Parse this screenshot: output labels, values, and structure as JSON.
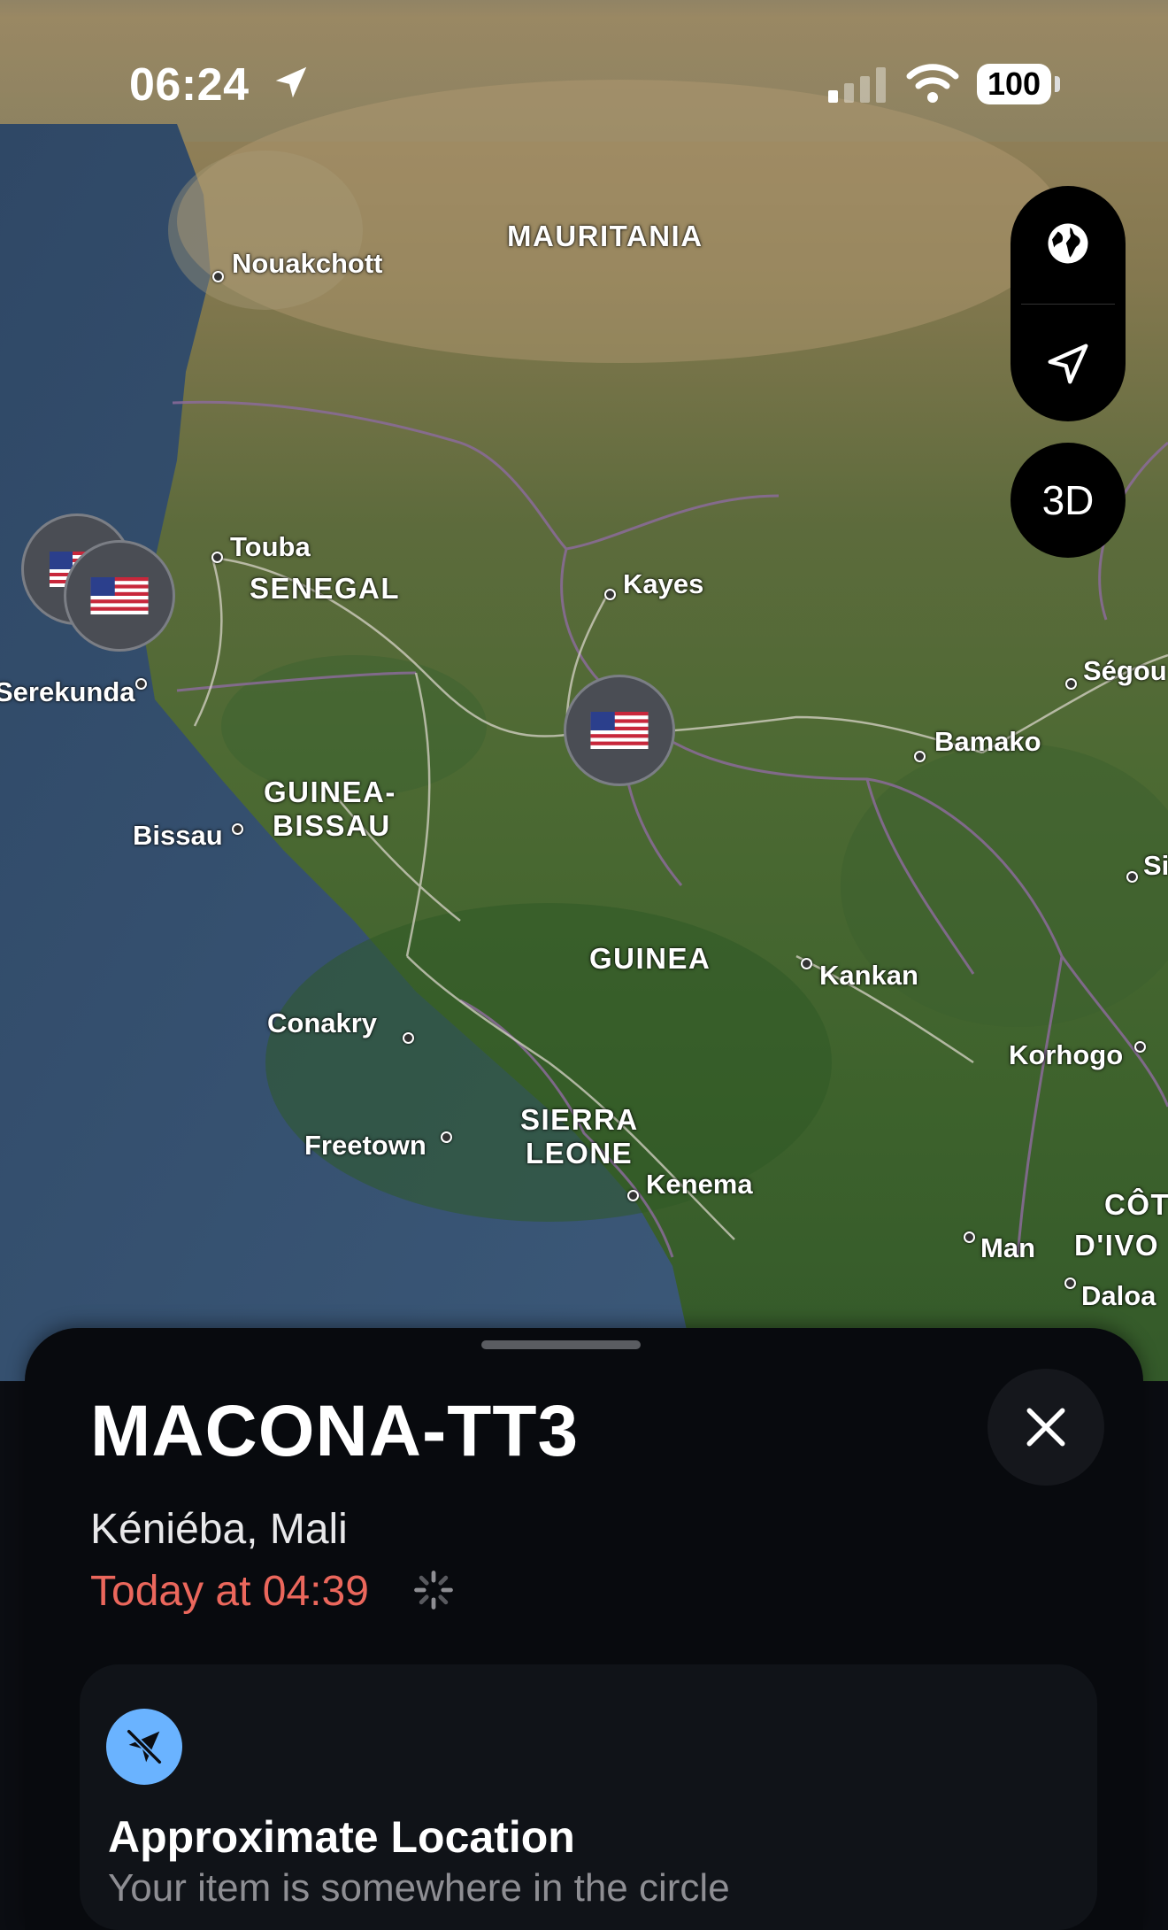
{
  "status_bar": {
    "time": "06:24",
    "battery": "100"
  },
  "map": {
    "countries": [
      {
        "name": "MAURITANIA"
      },
      {
        "name": "SENEGAL"
      },
      {
        "name": "GUINEA-"
      },
      {
        "name": "BISSAU"
      },
      {
        "name": "GUINEA"
      },
      {
        "name": "SIERRA"
      },
      {
        "name": "LEONE"
      },
      {
        "name": "CÔT"
      },
      {
        "name": "D'IVO"
      }
    ],
    "cities": [
      "Nouakchott",
      "Touba",
      "Kayes",
      "Serekunda",
      "Bamako",
      "Ségou",
      "Bissau",
      "Kankan",
      "Si",
      "Conakry",
      "Korhogo",
      "Freetown",
      "Kenema",
      "Man",
      "Daloa"
    ],
    "controls": {
      "map_mode": "globe-icon",
      "locate": "location-arrow-icon",
      "view_3d": "3D"
    }
  },
  "sheet": {
    "title": "MACONA-TT3",
    "location": "Kéniéba, Mali",
    "updated": "Today at 04:39",
    "approx_title": "Approximate Location",
    "approx_subtitle": "Your item is somewhere in the circle"
  },
  "colors": {
    "accent_red": "#eb675c",
    "approx_icon_bg": "#6ab3ff"
  }
}
